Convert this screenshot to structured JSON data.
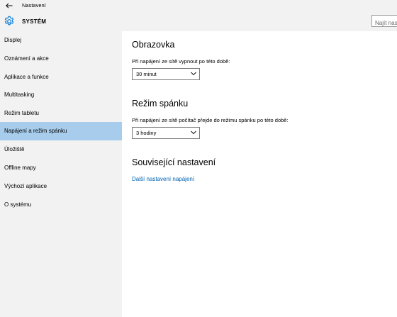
{
  "window": {
    "title": "Nastavení"
  },
  "header": {
    "title": "SYSTÉM",
    "search_placeholder": "Najít nastavení"
  },
  "sidebar": {
    "items": [
      {
        "label": "Displej"
      },
      {
        "label": "Oznámení a akce"
      },
      {
        "label": "Aplikace a funkce"
      },
      {
        "label": "Multitasking"
      },
      {
        "label": "Režim tabletu"
      },
      {
        "label": "Napájení a režim spánku",
        "selected": true
      },
      {
        "label": "Úložiště"
      },
      {
        "label": "Offline mapy"
      },
      {
        "label": "Výchozí aplikace"
      },
      {
        "label": "O systému"
      }
    ]
  },
  "main": {
    "screen": {
      "title": "Obrazovka",
      "label": "Při napájení ze sítě vypnout po této době:",
      "value": "30 minut"
    },
    "sleep": {
      "title": "Režim spánku",
      "label": "Při napájení ze sítě počítač přejde do režimu spánku po této době:",
      "value": "3 hodiny"
    },
    "related": {
      "title": "Související nastavení",
      "link": "Další nastavení napájení"
    }
  },
  "colors": {
    "selected_bg": "#a8cdec",
    "sidebar_bg": "#f2f2f2",
    "link": "#0063b1",
    "gear_icon": "#0078d7"
  },
  "icons": {
    "back": "back-arrow-icon",
    "settings": "gear-icon",
    "dropdown": "chevron-down-icon"
  }
}
